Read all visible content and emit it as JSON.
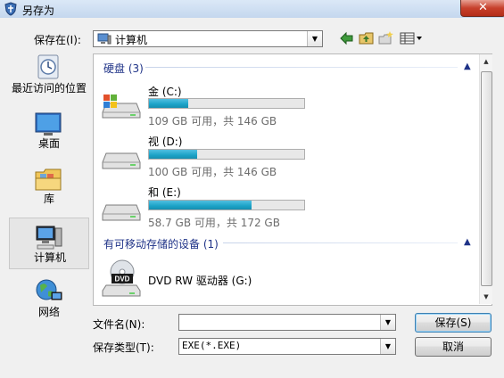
{
  "window": {
    "title": "另存为",
    "close_glyph": "✕"
  },
  "toolbar": {
    "save_in_label": "保存在(I):",
    "location": "计算机",
    "icons": [
      "back-icon",
      "up-folder-icon",
      "new-folder-icon",
      "view-menu-icon"
    ]
  },
  "places": [
    {
      "label": "最近访问的位置",
      "icon": "recent-places-icon"
    },
    {
      "label": "桌面",
      "icon": "desktop-icon"
    },
    {
      "label": "库",
      "icon": "libraries-icon"
    },
    {
      "label": "计算机",
      "icon": "computer-icon",
      "selected": true
    },
    {
      "label": "网络",
      "icon": "network-icon"
    }
  ],
  "groups": {
    "hdd": {
      "header": "硬盘 (3)"
    },
    "removable": {
      "header": "有可移动存储的设备 (1)"
    }
  },
  "drives": [
    {
      "name": "金 (C:)",
      "size_text": "109 GB 可用，共 146 GB",
      "used_fraction": 0.25
    },
    {
      "name": "视 (D:)",
      "size_text": "100 GB 可用，共 146 GB",
      "used_fraction": 0.31
    },
    {
      "name": "和 (E:)",
      "size_text": "58.7 GB 可用，共 172 GB",
      "used_fraction": 0.66
    }
  ],
  "removable": [
    {
      "name": "DVD RW 驱动器 (G:)",
      "icon_text": "DVD"
    }
  ],
  "form": {
    "filename_label": "文件名(N):",
    "filename_value": "",
    "filetype_label": "保存类型(T):",
    "filetype_value": "EXE(*.EXE)"
  },
  "buttons": {
    "save": "保存(S)",
    "cancel": "取消"
  },
  "colors": {
    "accent": "#1e3287",
    "bar_fill": "#1ca3c7",
    "close": "#c7402c"
  }
}
